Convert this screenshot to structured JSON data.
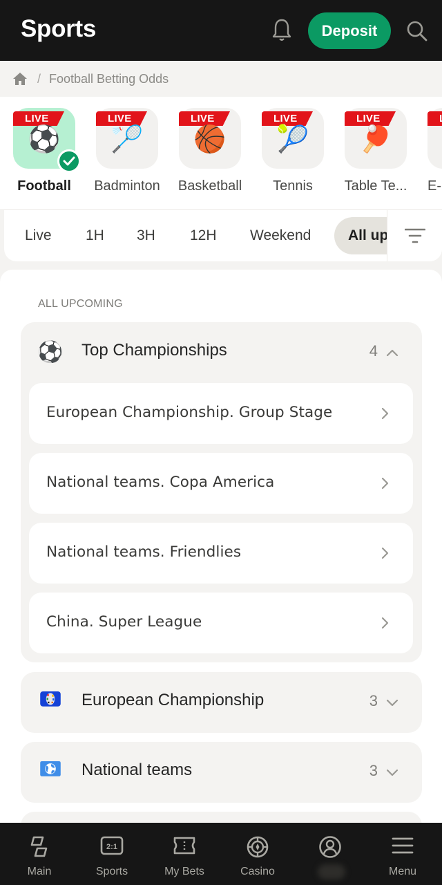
{
  "header": {
    "title": "Sports",
    "deposit_label": "Deposit",
    "icons": [
      "bell-icon",
      "search-icon"
    ]
  },
  "breadcrumb": {
    "home_icon": "home-icon",
    "separator": "/",
    "current": "Football Betting Odds"
  },
  "sports": {
    "live_badge": "LIVE",
    "items": [
      {
        "label": "Football",
        "emoji": "⚽",
        "live": true,
        "active": true
      },
      {
        "label": "Badminton",
        "emoji": "🏸",
        "live": true,
        "active": false
      },
      {
        "label": "Basketball",
        "emoji": "🏀",
        "live": true,
        "active": false
      },
      {
        "label": "Tennis",
        "emoji": "🎾",
        "live": true,
        "active": false
      },
      {
        "label": "Table Te...",
        "emoji": "🏓",
        "live": true,
        "active": false
      },
      {
        "label": "E-...",
        "emoji": "",
        "live": true,
        "active": false
      }
    ]
  },
  "time_filter": {
    "options": [
      "Live",
      "1H",
      "3H",
      "12H",
      "Weekend",
      "All up"
    ],
    "selected": "All up",
    "filter_icon": "filter-icon"
  },
  "content": {
    "section_title": "ALL UPCOMING",
    "groups": [
      {
        "name": "Top Championships",
        "icon": "⚽",
        "count": "4",
        "expanded": true,
        "items": [
          "European Championship. Group Stage",
          "National teams. Copa America",
          "National teams. Friendlies",
          "China. Super League"
        ]
      },
      {
        "name": "European Championship",
        "icon": "euro-trophy-icon",
        "count": "3",
        "expanded": false
      },
      {
        "name": "National teams",
        "icon": "globe-icon",
        "count": "3",
        "expanded": false
      }
    ]
  },
  "bottom_nav": {
    "items": [
      {
        "label": "Main",
        "icon": "main-icon"
      },
      {
        "label": "Sports",
        "icon": "scoreboard-icon",
        "icon_text": "2:1"
      },
      {
        "label": "My Bets",
        "icon": "ticket-icon"
      },
      {
        "label": "Casino",
        "icon": "casino-chip-icon"
      },
      {
        "label": "",
        "icon": "account-icon"
      },
      {
        "label": "Menu",
        "icon": "menu-icon"
      }
    ]
  },
  "colors": {
    "brand_green": "#0b9a63",
    "live_red": "#e2141a",
    "header_bg": "#161616",
    "active_tile": "#b6f0d2"
  }
}
